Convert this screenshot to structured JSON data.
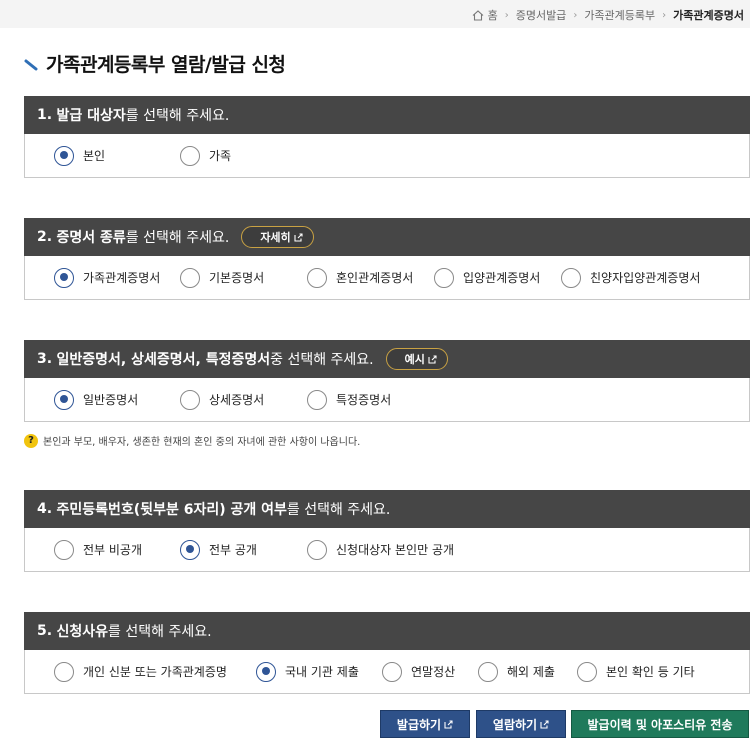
{
  "breadcrumb": {
    "items": [
      "홈",
      "증명서발급",
      "가족관계등록부"
    ],
    "current": "가족관계증명서"
  },
  "page": {
    "title": "가족관계등록부 열람/발급 신청"
  },
  "section1": {
    "num": "1.",
    "bold": "발급 대상자",
    "rest": "를 선택해 주세요.",
    "options": [
      "본인",
      "가족"
    ],
    "selected": 0
  },
  "section2": {
    "num": "2.",
    "bold": "증명서 종류",
    "rest": "를 선택해 주세요.",
    "pill": "자세히",
    "options": [
      "가족관계증명서",
      "기본증명서",
      "혼인관계증명서",
      "입양관계증명서",
      "친양자입양관계증명서"
    ],
    "selected": 0
  },
  "section3": {
    "num": "3.",
    "bold": "일반증명서, 상세증명서, 특정증명서",
    "rest": " 중 선택해 주세요.",
    "pill": "예시",
    "options": [
      "일반증명서",
      "상세증명서",
      "특정증명서"
    ],
    "selected": 0
  },
  "note": {
    "icon": "?",
    "text": "본인과 부모, 배우자, 생존한 현재의 혼인 중의 자녀에 관한 사항이 나옵니다."
  },
  "section4": {
    "num": "4.",
    "bold": "주민등록번호(뒷부분 6자리) 공개 여부",
    "rest": "를 선택해 주세요.",
    "options": [
      "전부 비공개",
      "전부 공개",
      "신청대상자 본인만 공개"
    ],
    "selected": 1
  },
  "section5": {
    "num": "5.",
    "bold": "신청사유",
    "rest": "를 선택해 주세요.",
    "options": [
      "개인 신분 또는 가족관계증명",
      "국내 기관 제출",
      "연말정산",
      "해외 제출",
      "본인 확인 등 기타"
    ],
    "selected": 1
  },
  "buttons": {
    "issue": "발급하기",
    "view": "열람하기",
    "history": "발급이력 및 아포스티유 전송"
  },
  "colors": {
    "header_bg": "#464646",
    "radio_selected": "#2f5596",
    "pill_border": "#c9a243",
    "button_blue": "#2e5189",
    "button_green": "#1f7a5b"
  }
}
